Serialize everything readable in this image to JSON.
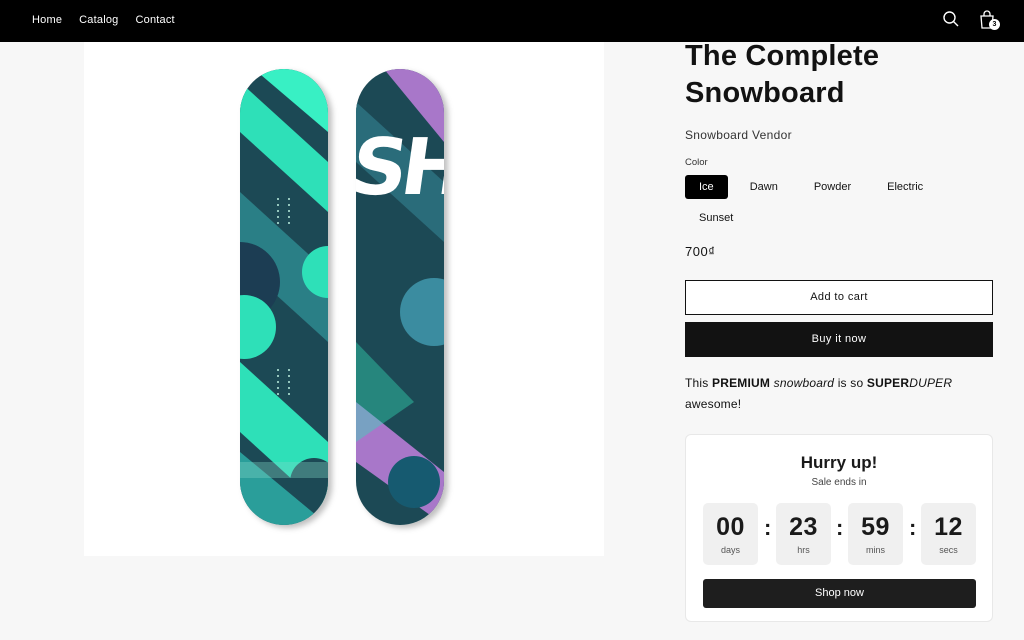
{
  "nav": {
    "links": [
      "Home",
      "Catalog",
      "Contact"
    ],
    "cart_count": "3",
    "icons": [
      "search-icon",
      "cart-icon"
    ]
  },
  "product": {
    "title": "The Complete Snowboard",
    "vendor": "Snowboard Vendor",
    "color_label": "Color",
    "colors": [
      "Ice",
      "Dawn",
      "Powder",
      "Electric",
      "Sunset"
    ],
    "selected_color": "Ice",
    "price": "700₫",
    "add_to_cart": "Add to cart",
    "buy_now": "Buy it now",
    "description": {
      "p1": "This ",
      "b1": "PREMIUM",
      "p2": " ",
      "i1": "snowboard",
      "p3": " is so ",
      "b2": "SUPER",
      "i2": "DUPER",
      "p4": " awesome!"
    },
    "image_text": "SHOPIFY"
  },
  "timer": {
    "title": "Hurry up!",
    "subtitle": "Sale ends in",
    "days": "00",
    "days_label": "days",
    "hours": "23",
    "hours_label": "hrs",
    "mins": "59",
    "mins_label": "mins",
    "secs": "12",
    "secs_label": "secs",
    "separator": ":",
    "button": "Shop now"
  },
  "colors": {
    "nav_bg": "#000000",
    "board_teal": "#2fe0b8",
    "board_dark": "#1f4a55",
    "board_purple": "#a877c9"
  }
}
